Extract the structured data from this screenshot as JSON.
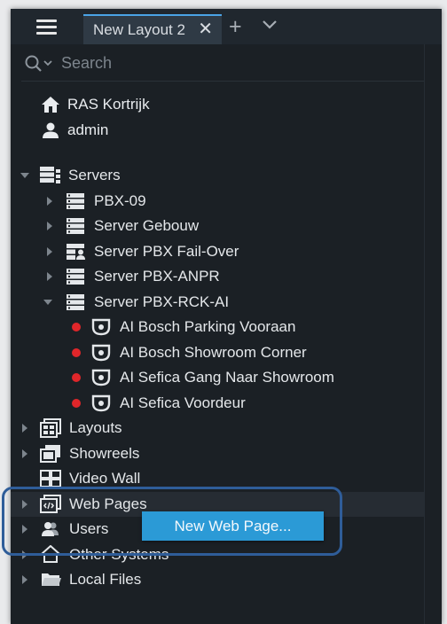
{
  "tabbar": {
    "active_tab": "New Layout 2",
    "close_glyph": "✕",
    "add_glyph": "+"
  },
  "search": {
    "placeholder": "Search"
  },
  "system": {
    "name": "RAS Kortrijk",
    "user": "admin"
  },
  "tree": {
    "servers": {
      "label": "Servers",
      "items": [
        {
          "label": "PBX-09",
          "icon": "server-icon"
        },
        {
          "label": "Server Gebouw",
          "icon": "server-icon"
        },
        {
          "label": "Server PBX Fail-Over",
          "icon": "server-failover-icon"
        },
        {
          "label": "Server PBX-ANPR",
          "icon": "server-icon"
        },
        {
          "label": "Server PBX-RCK-AI",
          "icon": "server-icon",
          "cameras": [
            {
              "label": "AI Bosch Parking Vooraan",
              "status_color": "#e0262a"
            },
            {
              "label": "AI Bosch Showroom Corner",
              "status_color": "#e0262a"
            },
            {
              "label": "AI Sefica Gang Naar Showroom",
              "status_color": "#e0262a"
            },
            {
              "label": "AI Sefica Voordeur",
              "status_color": "#e0262a"
            }
          ]
        }
      ]
    },
    "layouts": "Layouts",
    "showreels": "Showreels",
    "video_wall": "Video Wall",
    "web_pages": "Web Pages",
    "users": "Users",
    "other_systems": "Other Systems",
    "local_files": "Local Files"
  },
  "context_button": {
    "label": "New Web Page..."
  },
  "colors": {
    "panel_bg": "#1b2025",
    "accent": "#2b9ad6",
    "highlight_frame": "#2f5d99",
    "camera_offline": "#e0262a"
  }
}
